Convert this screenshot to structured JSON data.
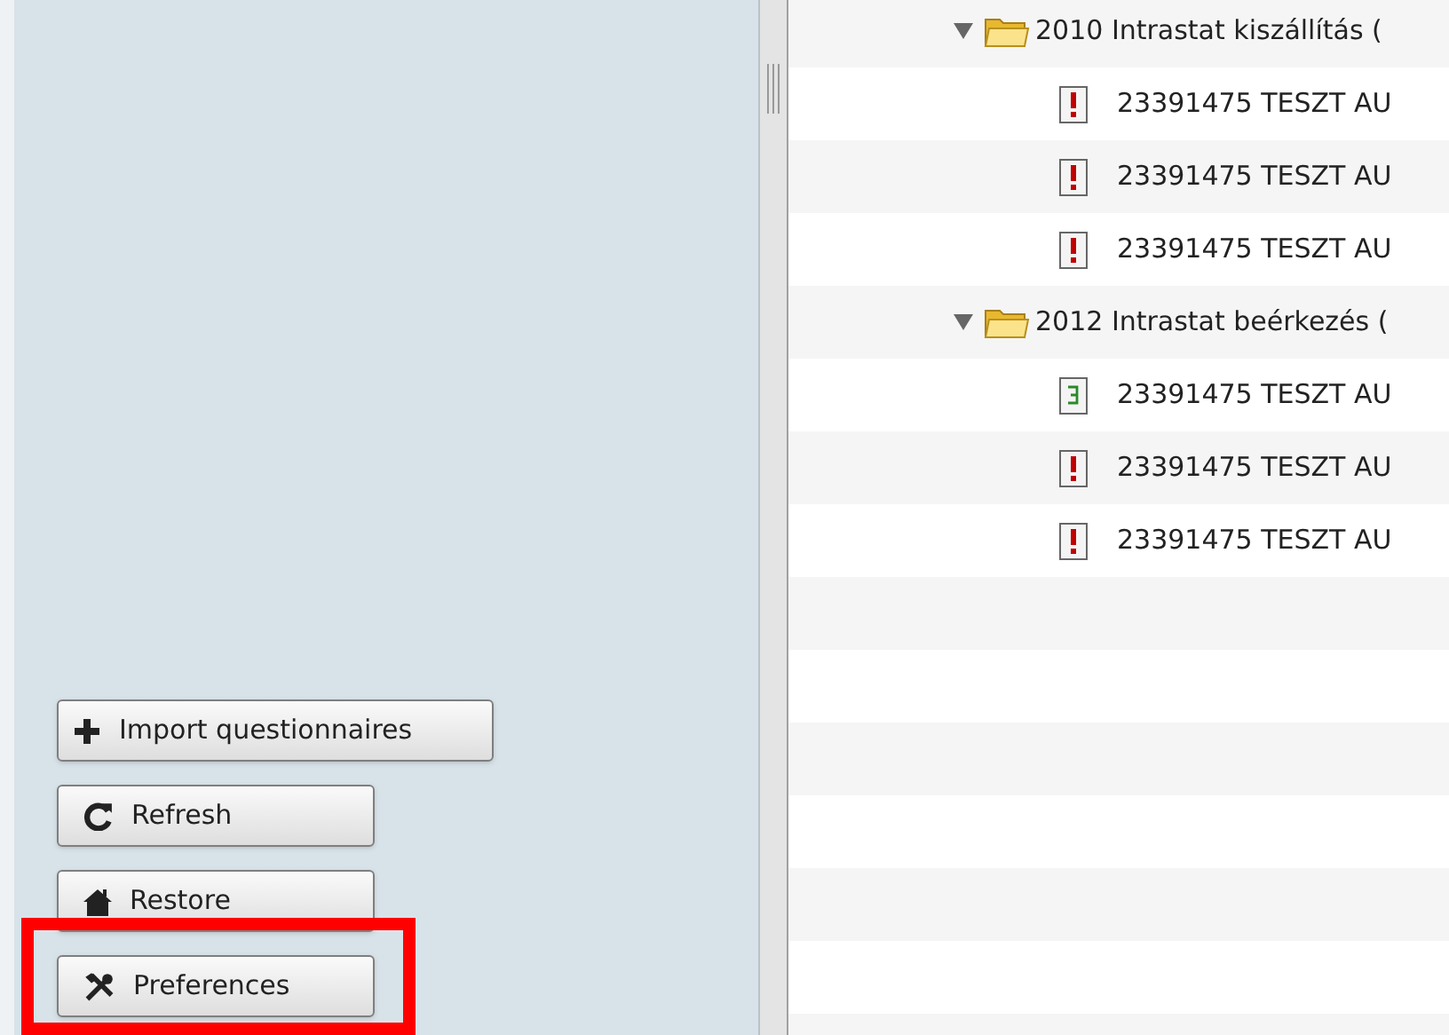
{
  "sidebar": {
    "buttons": [
      {
        "kind": "import",
        "label": "Import questionnaires",
        "highlighted": false
      },
      {
        "kind": "refresh",
        "label": "Refresh",
        "highlighted": false
      },
      {
        "kind": "restore",
        "label": "Restore",
        "highlighted": false
      },
      {
        "kind": "preferences",
        "label": "Preferences",
        "highlighted": true
      }
    ]
  },
  "tree": {
    "rows": [
      {
        "kind": "folder",
        "label": "2010 Intrastat kiszállítás (",
        "expanded": true
      },
      {
        "kind": "item",
        "flagged": true,
        "label": "23391475 TESZT AU"
      },
      {
        "kind": "item",
        "flagged": true,
        "label": "23391475 TESZT AU"
      },
      {
        "kind": "item",
        "flagged": true,
        "label": "23391475 TESZT AU"
      },
      {
        "kind": "folder",
        "label": "2012 Intrastat beérkezés (",
        "expanded": true
      },
      {
        "kind": "item",
        "flagged": false,
        "label": "23391475 TESZT AU"
      },
      {
        "kind": "item",
        "flagged": true,
        "label": "23391475 TESZT AU"
      },
      {
        "kind": "item",
        "flagged": true,
        "label": "23391475 TESZT AU"
      }
    ]
  }
}
